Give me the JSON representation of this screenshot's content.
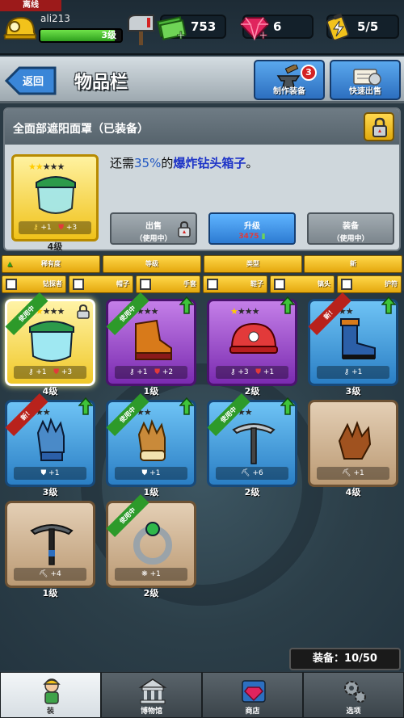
{
  "status": {
    "offline_label": "离线"
  },
  "player": {
    "name": "ali213",
    "level": "3级",
    "xp_fraction": 0.92
  },
  "resources": [
    {
      "icon": "cash-icon",
      "value": "753"
    },
    {
      "icon": "gem-icon",
      "value": "6"
    },
    {
      "icon": "energy-battery-icon",
      "value": "5/5"
    }
  ],
  "header": {
    "back_label": "返回",
    "title": "物品栏",
    "craft_label": "制作装备",
    "craft_badge": "3",
    "quicksell_label": "快速出售"
  },
  "detail": {
    "item_name": "全面部遮阳面罩（已装备）",
    "desc_prefix": "还需",
    "desc_pct": "35%",
    "desc_mid": "的",
    "desc_target": "爆炸钻头箱子",
    "desc_suffix": "。",
    "level": "4级",
    "stat1": "+1",
    "stat2": "+3",
    "sell_line1": "出售",
    "sell_line2": "（使用中）",
    "upgrade_label": "升级",
    "upgrade_cost": "3475",
    "equip_line1": "装备",
    "equip_line2": "（使用中）"
  },
  "sort_options": [
    "稀有度",
    "等级",
    "类型",
    "新"
  ],
  "filters": [
    "钻探者",
    "帽子",
    "手套",
    "鞋子",
    "镐头",
    "护符"
  ],
  "items": [
    {
      "name": "face-shield",
      "level": "4级",
      "stars": 2,
      "max_stars": 5,
      "frame": "gold",
      "ribbon": "使用中",
      "ribbon_color": "green",
      "locked": true,
      "upgrade": false,
      "stat1": "+1",
      "stat2": "+3"
    },
    {
      "name": "boots-purple",
      "level": "1级",
      "stars": 0,
      "max_stars": 4,
      "frame": "purple",
      "ribbon": "使用中",
      "ribbon_color": "green",
      "locked": false,
      "upgrade": true,
      "stat1": "+1",
      "stat2": "+2"
    },
    {
      "name": "red-helmet",
      "level": "2级",
      "stars": 1,
      "max_stars": 4,
      "frame": "purple",
      "ribbon": "",
      "ribbon_color": "",
      "locked": false,
      "upgrade": true,
      "stat1": "+3",
      "stat2": "+1"
    },
    {
      "name": "blue-boot",
      "level": "3级",
      "stars": 1,
      "max_stars": 3,
      "frame": "blue",
      "ribbon": "新！",
      "ribbon_color": "red",
      "locked": false,
      "upgrade": true,
      "stat1": "+1",
      "stat2": ""
    },
    {
      "name": "blue-glove",
      "level": "3级",
      "stars": 0,
      "max_stars": 3,
      "frame": "blue",
      "ribbon": "新！",
      "ribbon_color": "red",
      "locked": false,
      "upgrade": true,
      "stat1": "+1",
      "stat2": ""
    },
    {
      "name": "fur-glove",
      "level": "1级",
      "stars": 0,
      "max_stars": 3,
      "frame": "blue",
      "ribbon": "使用中",
      "ribbon_color": "green",
      "locked": false,
      "upgrade": true,
      "stat1": "+1",
      "stat2": ""
    },
    {
      "name": "pickaxe-steel",
      "level": "2级",
      "stars": 0,
      "max_stars": 3,
      "frame": "blue",
      "ribbon": "使用中",
      "ribbon_color": "green",
      "locked": false,
      "upgrade": true,
      "stat1": "+6",
      "stat2": ""
    },
    {
      "name": "leather-glove",
      "level": "4级",
      "stars": 0,
      "max_stars": 0,
      "frame": "brown",
      "ribbon": "",
      "ribbon_color": "",
      "locked": false,
      "upgrade": false,
      "stat1": "+1",
      "stat2": ""
    },
    {
      "name": "pickaxe-basic",
      "level": "1级",
      "stars": 0,
      "max_stars": 0,
      "frame": "brown",
      "ribbon": "",
      "ribbon_color": "",
      "locked": false,
      "upgrade": false,
      "stat1": "+4",
      "stat2": ""
    },
    {
      "name": "emerald-ring",
      "level": "2级",
      "stars": 0,
      "max_stars": 0,
      "frame": "brown",
      "ribbon": "使用中",
      "ribbon_color": "green",
      "locked": false,
      "upgrade": false,
      "stat1": "+1",
      "stat2": ""
    }
  ],
  "capacity": "装备：10/50",
  "nav": [
    "装",
    "博物馆",
    "商店",
    "选项"
  ]
}
